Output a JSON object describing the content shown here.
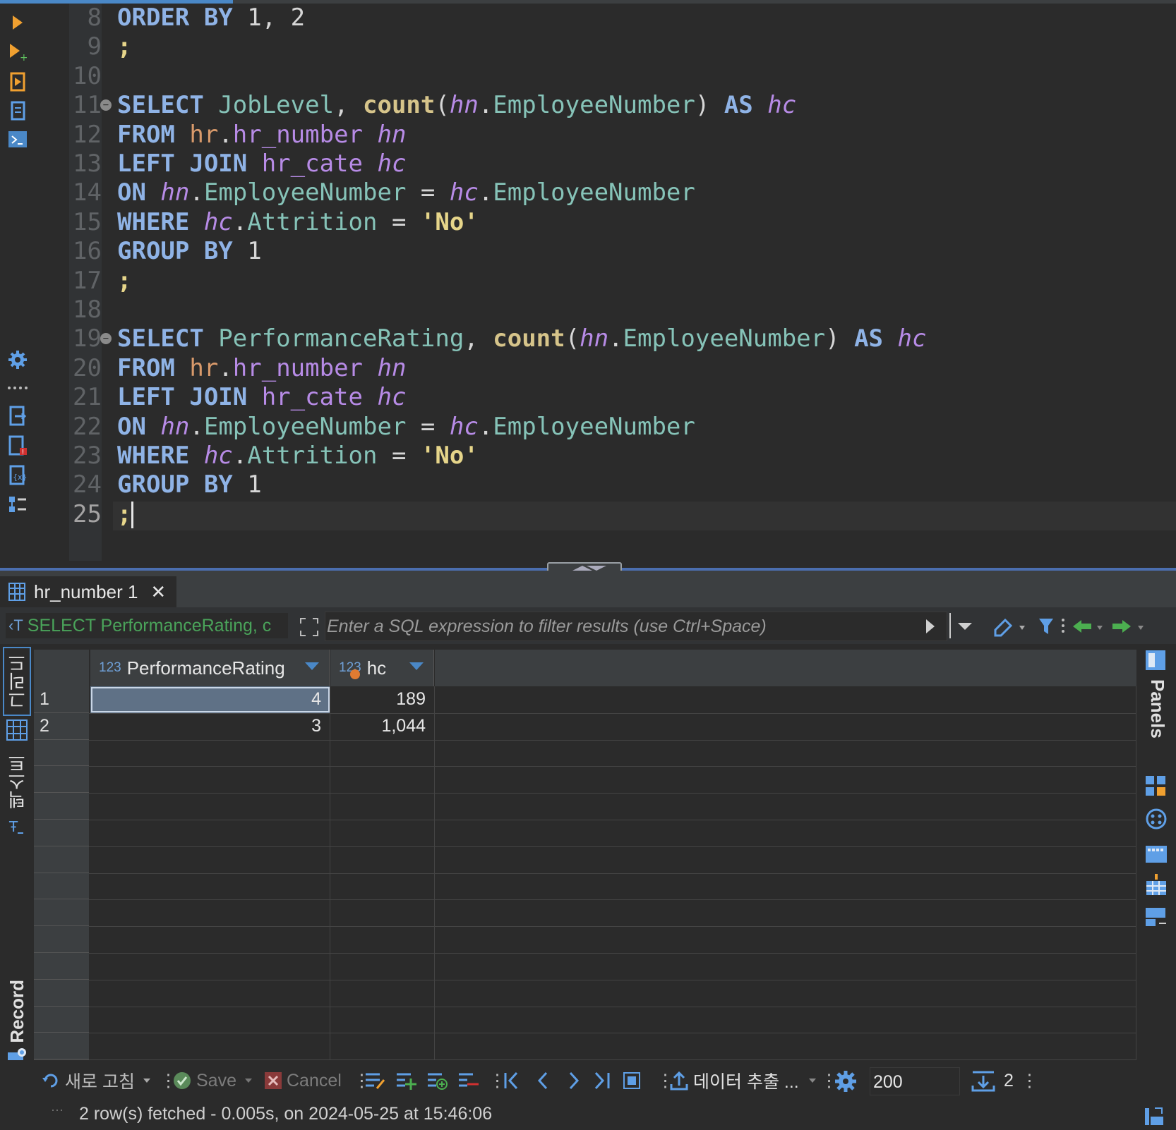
{
  "editor": {
    "lines": [
      {
        "num": "8",
        "tokens": [
          [
            "kw",
            "ORDER BY "
          ],
          [
            "plain",
            "1, 2"
          ]
        ]
      },
      {
        "num": "9",
        "tokens": [
          [
            "str",
            ";"
          ]
        ]
      },
      {
        "num": "10",
        "tokens": []
      },
      {
        "num": "11",
        "fold": true,
        "tokens": [
          [
            "kw",
            "SELECT "
          ],
          [
            "tbl",
            "JobLevel"
          ],
          [
            "plain",
            ", "
          ],
          [
            "fn",
            "count"
          ],
          [
            "plain",
            "("
          ],
          [
            "al",
            "hn"
          ],
          [
            "plain",
            "."
          ],
          [
            "tbl",
            "EmployeeNumber"
          ],
          [
            "plain",
            ") "
          ],
          [
            "kw",
            "AS "
          ],
          [
            "al",
            "hc"
          ]
        ]
      },
      {
        "num": "12",
        "tokens": [
          [
            "kw",
            "FROM "
          ],
          [
            "sch",
            "hr"
          ],
          [
            "plain",
            "."
          ],
          [
            "al2",
            "hr_number "
          ],
          [
            "al",
            "hn"
          ]
        ]
      },
      {
        "num": "13",
        "tokens": [
          [
            "kw",
            "LEFT JOIN "
          ],
          [
            "al2",
            "hr_cate "
          ],
          [
            "al",
            "hc"
          ]
        ]
      },
      {
        "num": "14",
        "tokens": [
          [
            "kw",
            "ON "
          ],
          [
            "al",
            "hn"
          ],
          [
            "plain",
            "."
          ],
          [
            "tbl",
            "EmployeeNumber"
          ],
          [
            "plain",
            " = "
          ],
          [
            "al",
            "hc"
          ],
          [
            "plain",
            "."
          ],
          [
            "tbl",
            "EmployeeNumber"
          ]
        ]
      },
      {
        "num": "15",
        "tokens": [
          [
            "kw",
            "WHERE "
          ],
          [
            "al",
            "hc"
          ],
          [
            "plain",
            "."
          ],
          [
            "tbl",
            "Attrition"
          ],
          [
            "plain",
            " = "
          ],
          [
            "str",
            "'No'"
          ]
        ]
      },
      {
        "num": "16",
        "tokens": [
          [
            "kw",
            "GROUP BY "
          ],
          [
            "plain",
            "1"
          ]
        ]
      },
      {
        "num": "17",
        "tokens": [
          [
            "str",
            ";"
          ]
        ]
      },
      {
        "num": "18",
        "tokens": []
      },
      {
        "num": "19",
        "fold": true,
        "tokens": [
          [
            "kw",
            "SELECT "
          ],
          [
            "tbl",
            "PerformanceRating"
          ],
          [
            "plain",
            ", "
          ],
          [
            "fn",
            "count"
          ],
          [
            "plain",
            "("
          ],
          [
            "al",
            "hn"
          ],
          [
            "plain",
            "."
          ],
          [
            "tbl",
            "EmployeeNumber"
          ],
          [
            "plain",
            ") "
          ],
          [
            "kw",
            "AS "
          ],
          [
            "al",
            "hc"
          ]
        ]
      },
      {
        "num": "20",
        "tokens": [
          [
            "kw",
            "FROM "
          ],
          [
            "sch",
            "hr"
          ],
          [
            "plain",
            "."
          ],
          [
            "al2",
            "hr_number "
          ],
          [
            "al",
            "hn"
          ]
        ]
      },
      {
        "num": "21",
        "tokens": [
          [
            "kw",
            "LEFT JOIN "
          ],
          [
            "al2",
            "hr_cate "
          ],
          [
            "al",
            "hc"
          ]
        ]
      },
      {
        "num": "22",
        "tokens": [
          [
            "kw",
            "ON "
          ],
          [
            "al",
            "hn"
          ],
          [
            "plain",
            "."
          ],
          [
            "tbl",
            "EmployeeNumber"
          ],
          [
            "plain",
            " = "
          ],
          [
            "al",
            "hc"
          ],
          [
            "plain",
            "."
          ],
          [
            "tbl",
            "EmployeeNumber"
          ]
        ]
      },
      {
        "num": "23",
        "tokens": [
          [
            "kw",
            "WHERE "
          ],
          [
            "al",
            "hc"
          ],
          [
            "plain",
            "."
          ],
          [
            "tbl",
            "Attrition"
          ],
          [
            "plain",
            " = "
          ],
          [
            "str",
            "'No'"
          ]
        ]
      },
      {
        "num": "24",
        "tokens": [
          [
            "kw",
            "GROUP BY "
          ],
          [
            "plain",
            "1"
          ]
        ]
      },
      {
        "num": "25",
        "current": true,
        "caret": true,
        "tokens": [
          [
            "str",
            ";"
          ]
        ]
      }
    ]
  },
  "results": {
    "tab_label": "hr_number 1",
    "tab_close": "✕",
    "query_preview": "SELECT PerformanceRating, c",
    "query_prefix_icon": "‹T",
    "filter_placeholder": "Enter a SQL expression to filter results (use Ctrl+Space)",
    "vertical_tabs": {
      "grid": "그리드",
      "text": "텍스트",
      "record": "Record"
    },
    "right_panel_label": "Panels",
    "columns": [
      {
        "type": "123",
        "name": "PerformanceRating"
      },
      {
        "type": "123",
        "name": "hc"
      }
    ],
    "rows": [
      {
        "num": "1",
        "values": [
          "4",
          "189"
        ]
      },
      {
        "num": "2",
        "values": [
          "3",
          "1,044"
        ]
      }
    ]
  },
  "bottombar": {
    "refresh_label": "새로 고침",
    "save_label": "Save",
    "cancel_label": "Cancel",
    "export_label": "데이터 추출 ...",
    "fetch_size": "200",
    "row_count": "2"
  },
  "status": {
    "text": "2 row(s) fetched - 0.005s, on 2024-05-25 at 15:46:06"
  }
}
